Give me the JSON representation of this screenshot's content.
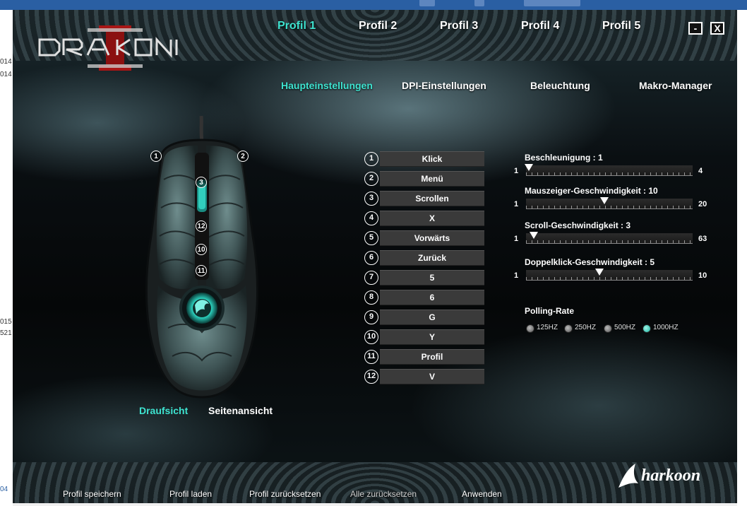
{
  "background": {
    "left_texts": [
      "014",
      "014",
      "015",
      "521",
      "04"
    ]
  },
  "profiles": {
    "active": 0,
    "tabs": [
      "Profil 1",
      "Profil 2",
      "Profil 3",
      "Profil 4",
      "Profil 5"
    ]
  },
  "window": {
    "minimize": "-",
    "close": "X"
  },
  "nav": {
    "active": 0,
    "tabs": [
      "Haupteinstellungen",
      "DPI-Einstellungen",
      "Beleuchtung",
      "Makro-Manager"
    ]
  },
  "mouse_badges": [
    "1",
    "2",
    "3",
    "12",
    "10",
    "11"
  ],
  "views": {
    "top": "Draufsicht",
    "side": "Seitenansicht",
    "active": "top"
  },
  "assignments": [
    {
      "num": "1",
      "label": "Klick"
    },
    {
      "num": "2",
      "label": "Menü"
    },
    {
      "num": "3",
      "label": "Scrollen"
    },
    {
      "num": "4",
      "label": "X"
    },
    {
      "num": "5",
      "label": "Vorwärts"
    },
    {
      "num": "6",
      "label": "Zurück"
    },
    {
      "num": "7",
      "label": "5"
    },
    {
      "num": "8",
      "label": "6"
    },
    {
      "num": "9",
      "label": "G"
    },
    {
      "num": "10",
      "label": "Y"
    },
    {
      "num": "11",
      "label": "Profil"
    },
    {
      "num": "12",
      "label": "V"
    }
  ],
  "sliders": [
    {
      "label": "Beschleunigung : 1",
      "min": "1",
      "max": "4",
      "value": 1,
      "vmin": 1,
      "vmax": 4
    },
    {
      "label": "Mauszeiger-Geschwindigkeit : 10",
      "min": "1",
      "max": "20",
      "value": 10,
      "vmin": 1,
      "vmax": 20
    },
    {
      "label": "Scroll-Geschwindigkeit : 3",
      "min": "1",
      "max": "63",
      "value": 3,
      "vmin": 1,
      "vmax": 63
    },
    {
      "label": "Doppelklick-Geschwindigkeit : 5",
      "min": "1",
      "max": "10",
      "value": 5,
      "vmin": 1,
      "vmax": 10
    }
  ],
  "polling": {
    "title": "Polling-Rate",
    "options": [
      "125HZ",
      "250HZ",
      "500HZ",
      "1000HZ"
    ],
    "selected": 3
  },
  "footer": {
    "buttons": [
      "Profil speichern",
      "Profil laden",
      "Profil zurücksetzen",
      "Alle zurücksetzen",
      "Anwenden"
    ]
  },
  "colors": {
    "accent": "#3ee3d0",
    "button_bg": "#3a3a3a"
  }
}
